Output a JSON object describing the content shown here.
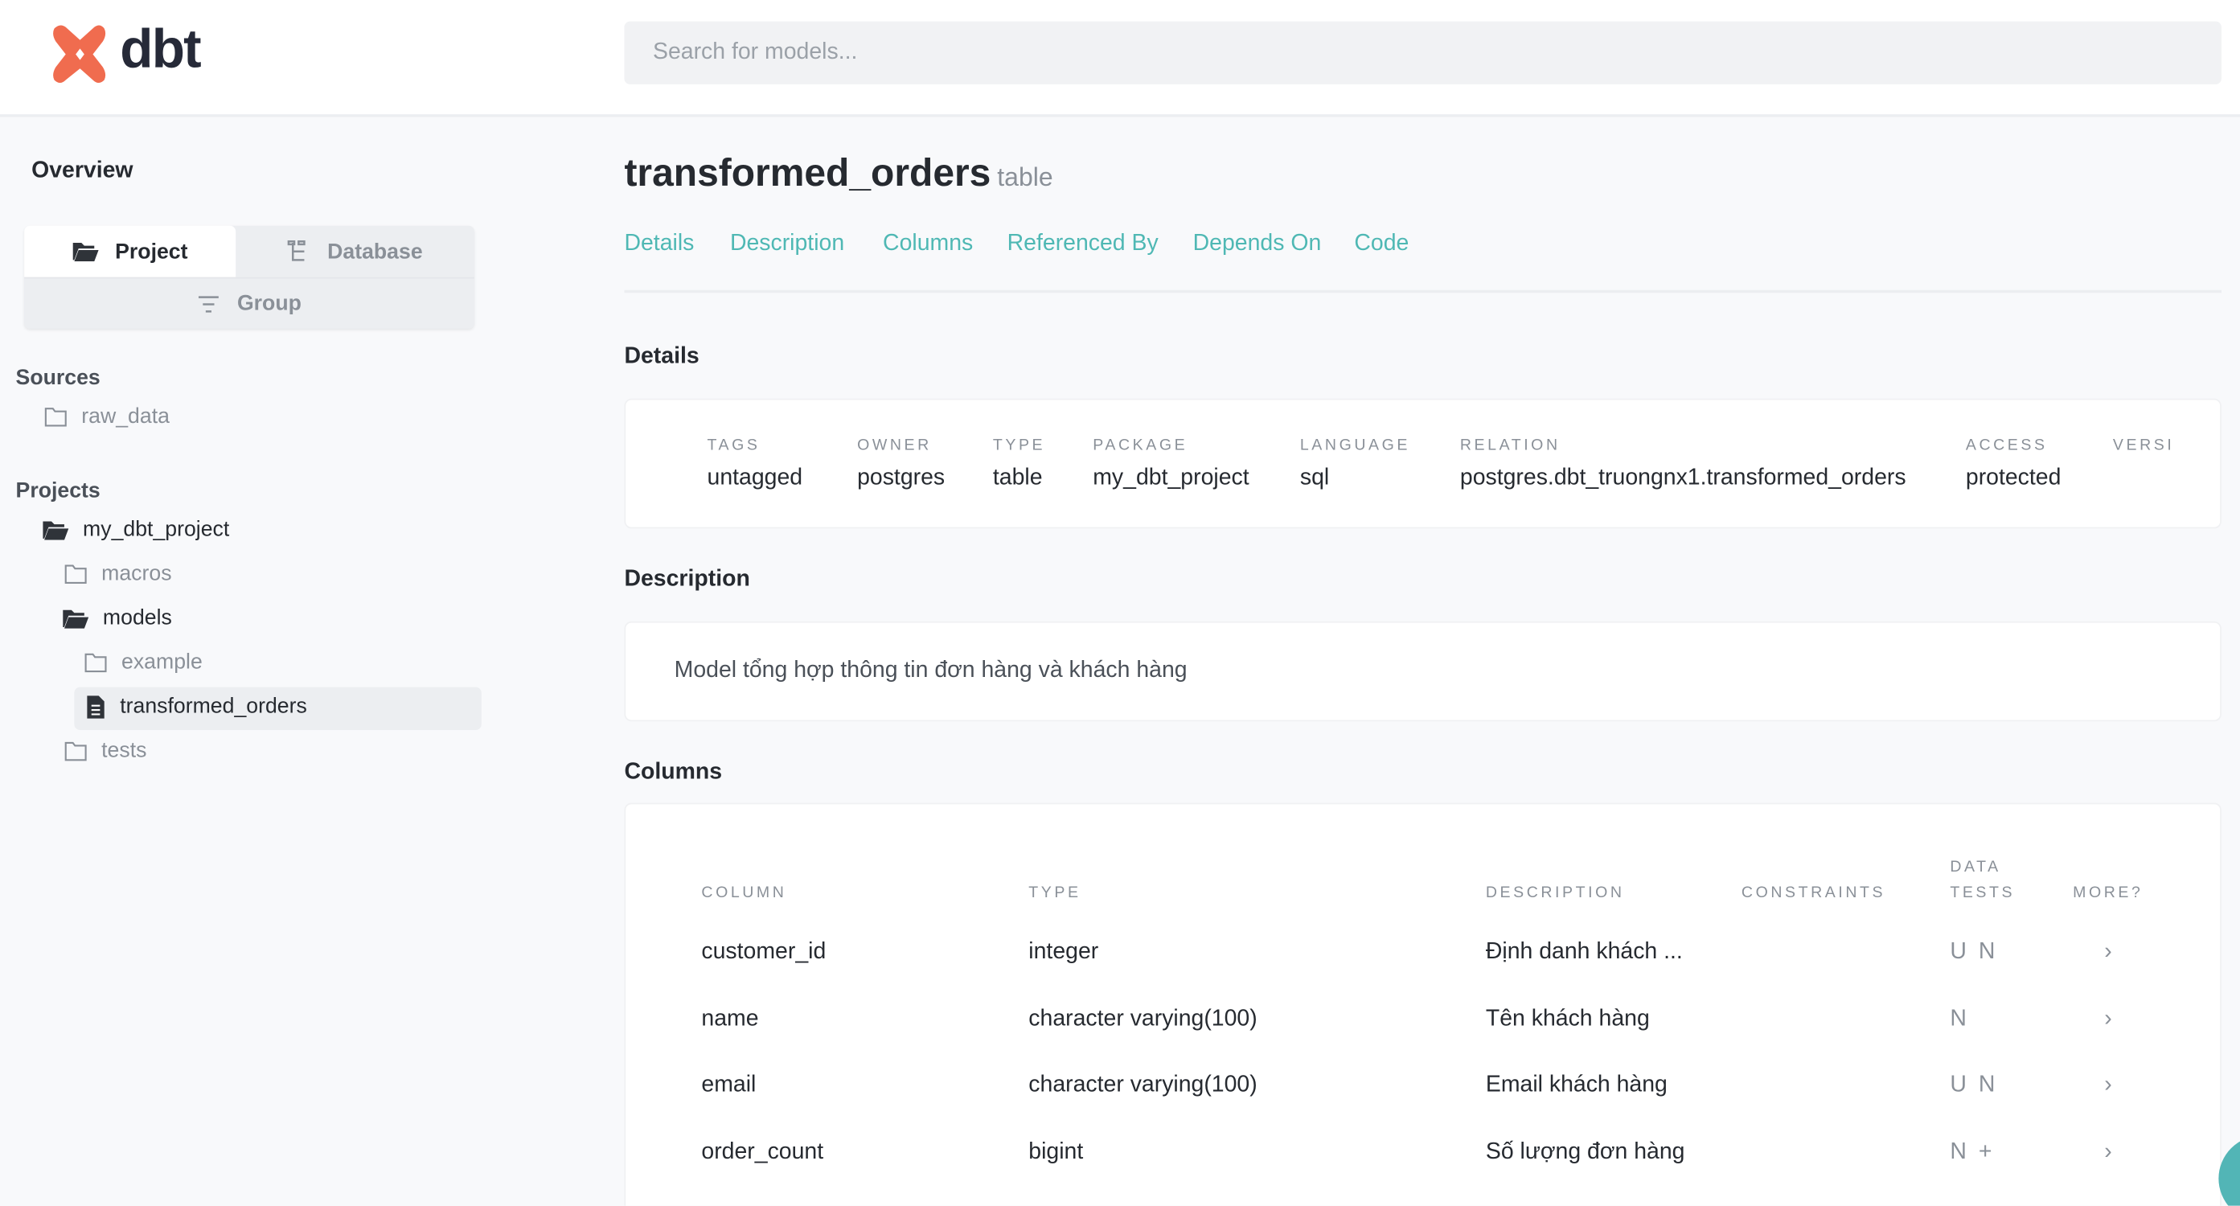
{
  "header": {
    "logo_text": "dbt",
    "search_placeholder": "Search for models..."
  },
  "sidebar": {
    "overview": "Overview",
    "toggle": {
      "project": "Project",
      "database": "Database",
      "group": "Group"
    },
    "sources_heading": "Sources",
    "sources": [
      {
        "label": "raw_data",
        "icon": "folder-outline-icon"
      }
    ],
    "projects_heading": "Projects",
    "projects": [
      {
        "label": "my_dbt_project",
        "icon": "folder-open-icon"
      },
      {
        "label": "macros",
        "icon": "folder-outline-icon"
      },
      {
        "label": "models",
        "icon": "folder-open-icon"
      },
      {
        "label": "example",
        "icon": "folder-outline-icon"
      },
      {
        "label": "transformed_orders",
        "icon": "file-icon",
        "selected": true
      },
      {
        "label": "tests",
        "icon": "folder-outline-icon"
      }
    ]
  },
  "main": {
    "title": "transformed_orders",
    "resource_type": "table",
    "tabs": [
      "Details",
      "Description",
      "Columns",
      "Referenced By",
      "Depends On",
      "Code"
    ],
    "details_heading": "Details",
    "details": [
      {
        "label": "TAGS",
        "value": "untagged"
      },
      {
        "label": "OWNER",
        "value": "postgres"
      },
      {
        "label": "TYPE",
        "value": "table"
      },
      {
        "label": "PACKAGE",
        "value": "my_dbt_project"
      },
      {
        "label": "LANGUAGE",
        "value": "sql"
      },
      {
        "label": "RELATION",
        "value": "postgres.dbt_truongnx1.transformed_orders"
      },
      {
        "label": "ACCESS",
        "value": "protected"
      },
      {
        "label": "VERSI",
        "value": ""
      }
    ],
    "description_heading": "Description",
    "description": "Model tổng hợp thông tin đơn hàng và khách hàng",
    "columns_heading": "Columns",
    "columns_headers": [
      "COLUMN",
      "TYPE",
      "DESCRIPTION",
      "CONSTRAINTS",
      "DATA TESTS",
      "MORE?"
    ],
    "columns_headers_data_tests_line1": "DATA",
    "columns_headers_data_tests_line2": "TESTS",
    "columns": [
      {
        "column": "customer_id",
        "type": "integer",
        "description": "Định danh khách ...",
        "constraints": "",
        "tests": "U N",
        "more": "›"
      },
      {
        "column": "name",
        "type": "character varying(100)",
        "description": "Tên khách hàng",
        "constraints": "",
        "tests": "N",
        "more": "›"
      },
      {
        "column": "email",
        "type": "character varying(100)",
        "description": "Email khách hàng",
        "constraints": "",
        "tests": "U N",
        "more": "›"
      },
      {
        "column": "order_count",
        "type": "bigint",
        "description": "Số lượng đơn hàng",
        "constraints": "",
        "tests": "N +",
        "more": "›"
      }
    ]
  },
  "colors": {
    "accent": "#4fb8b4",
    "logo": "#f06c4f"
  }
}
